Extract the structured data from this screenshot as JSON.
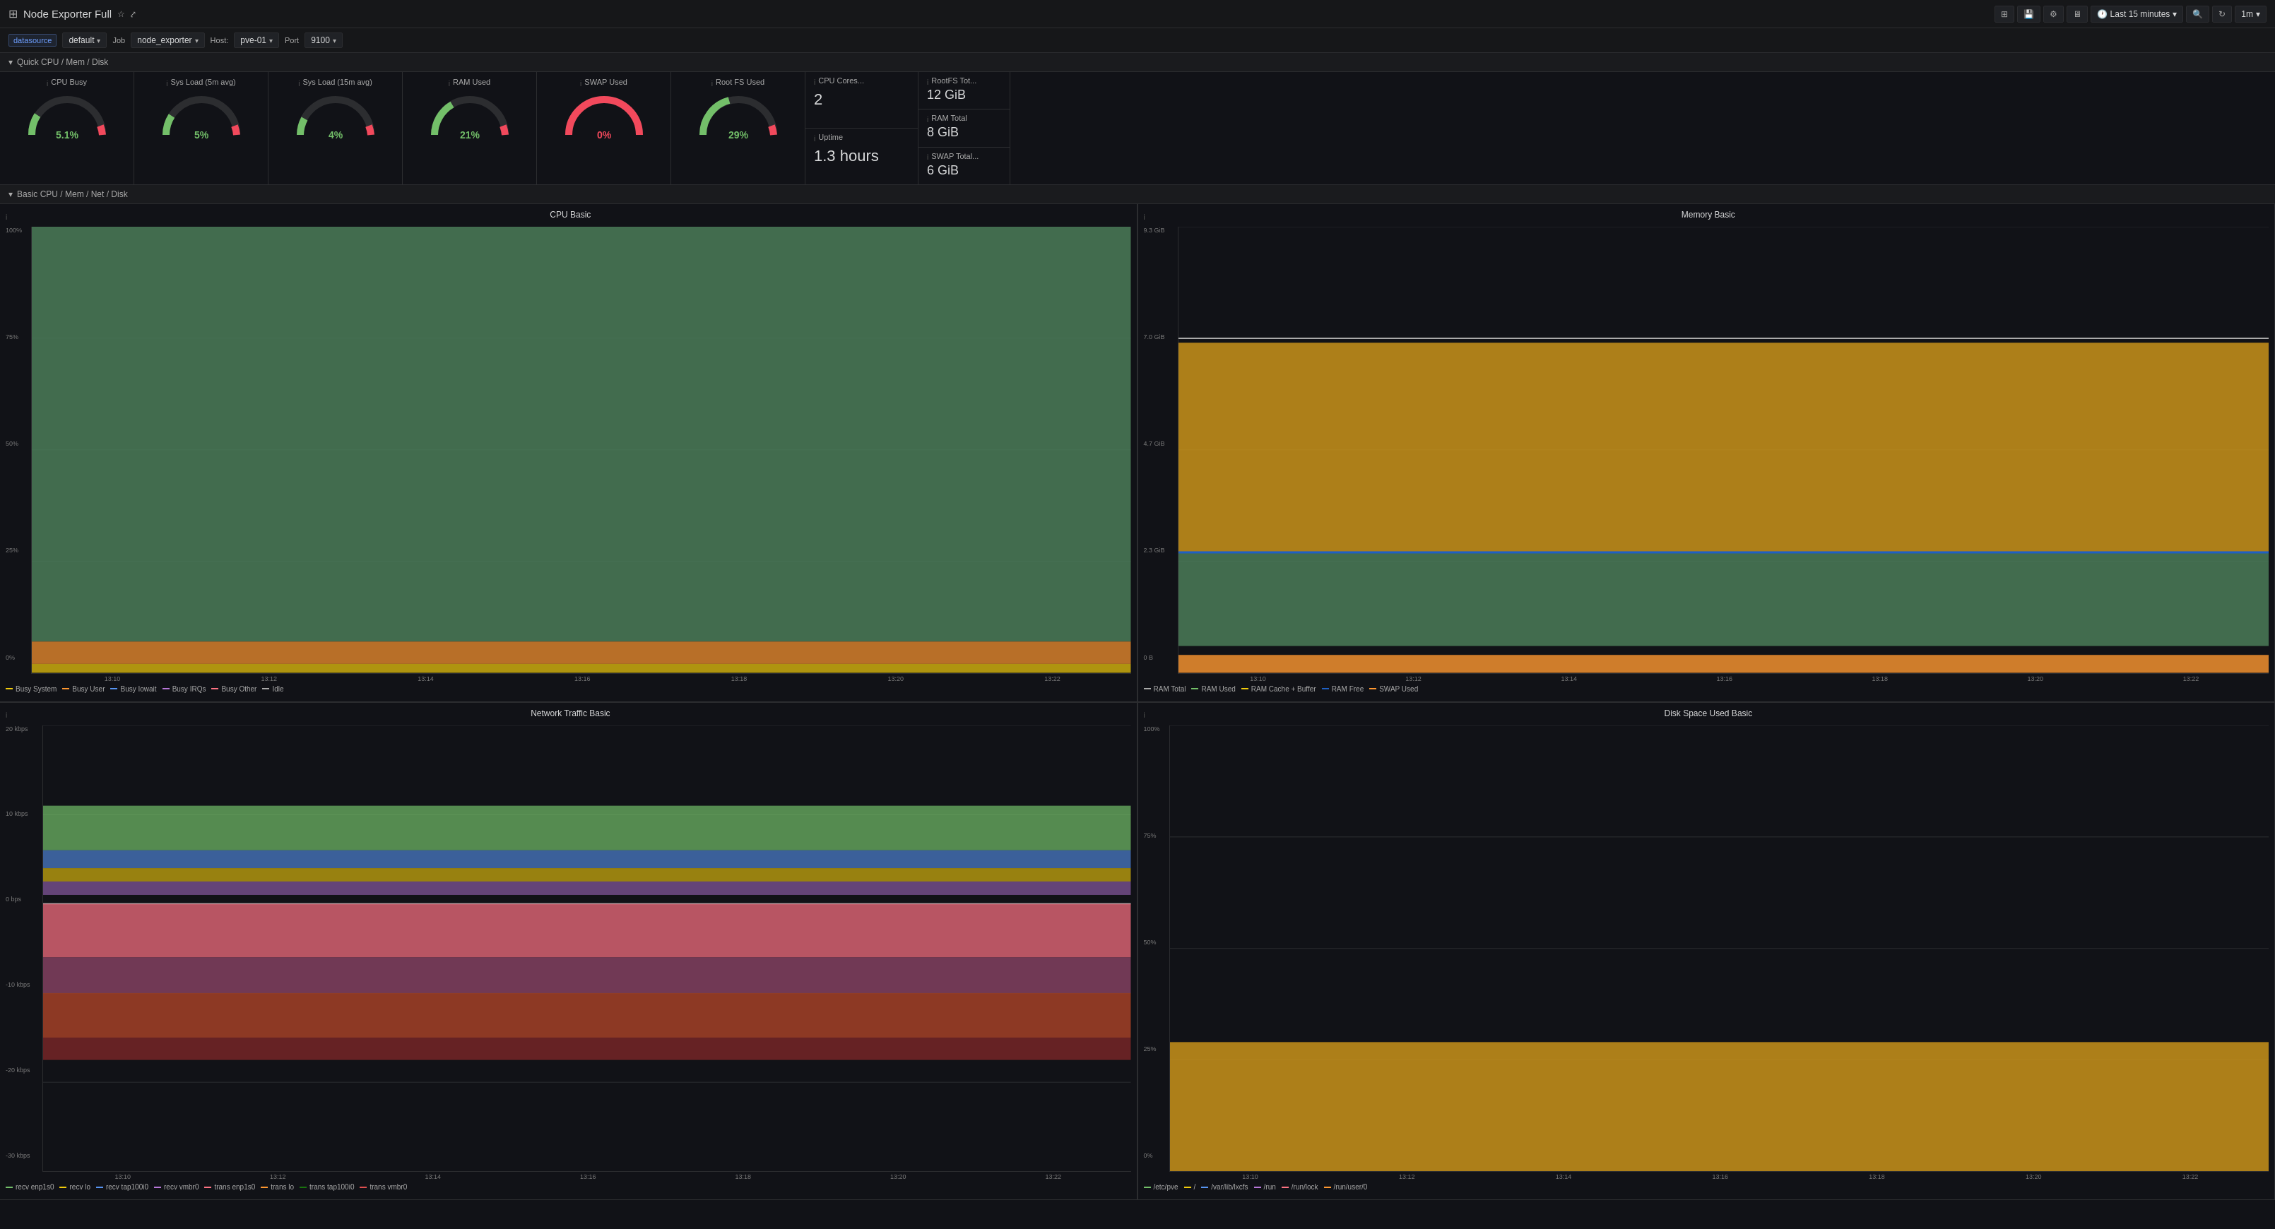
{
  "header": {
    "title": "Node Exporter Full",
    "time_range": "Last 15 minutes",
    "refresh": "1m"
  },
  "toolbar": {
    "datasource_label": "datasource",
    "datasource_value": "default",
    "job_label": "Job",
    "job_value": "node_exporter",
    "host_label": "Host:",
    "host_value": "pve-01",
    "port_label": "Port",
    "port_value": "9100"
  },
  "section_quick": "Quick CPU / Mem / Disk",
  "section_basic": "Basic CPU / Mem / Net / Disk",
  "gauges": [
    {
      "id": "cpu-busy",
      "title": "CPU Busy",
      "value": "5.1%",
      "pct": 5.1,
      "color": "#73bf69"
    },
    {
      "id": "sys-load-5m",
      "title": "Sys Load (5m avg)",
      "value": "5%",
      "pct": 5,
      "color": "#73bf69"
    },
    {
      "id": "sys-load-15m",
      "title": "Sys Load (15m avg)",
      "value": "4%",
      "pct": 4,
      "color": "#73bf69"
    },
    {
      "id": "ram-used",
      "title": "RAM Used",
      "value": "21%",
      "pct": 21,
      "color": "#73bf69"
    },
    {
      "id": "swap-used",
      "title": "SWAP Used",
      "value": "0%",
      "pct": 0,
      "color": "#f2495c"
    },
    {
      "id": "root-fs-used",
      "title": "Root FS Used",
      "value": "29%",
      "pct": 29,
      "color": "#73bf69"
    }
  ],
  "info_panels": [
    {
      "id": "cpu-cores",
      "title": "CPU Cores...",
      "value": "2"
    },
    {
      "id": "uptime",
      "title": "Uptime",
      "value": "1.3 hours"
    }
  ],
  "stat_panels": [
    {
      "id": "rootfs-total",
      "title": "RootFS Tot...",
      "value": "12 GiB"
    },
    {
      "id": "ram-total",
      "title": "RAM Total",
      "value": "8 GiB"
    },
    {
      "id": "swap-total",
      "title": "SWAP Total...",
      "value": "6 GiB"
    }
  ],
  "cpu_chart": {
    "title": "CPU Basic",
    "y_labels": [
      "100%",
      "75%",
      "50%",
      "25%",
      "0%"
    ],
    "x_labels": [
      "13:10",
      "13:12",
      "13:14",
      "13:16",
      "13:18",
      "13:20",
      "13:22"
    ],
    "legend": [
      {
        "label": "Busy System",
        "color": "#f2cc0c"
      },
      {
        "label": "Busy User",
        "color": "#ff9830"
      },
      {
        "label": "Busy Iowait",
        "color": "#5794f2"
      },
      {
        "label": "Busy IRQs",
        "color": "#b877d9"
      },
      {
        "label": "Busy Other",
        "color": "#ff7383"
      },
      {
        "label": "Idle",
        "color": "#aaa"
      }
    ]
  },
  "mem_chart": {
    "title": "Memory Basic",
    "y_labels": [
      "9.3 GiB",
      "7.0 GiB",
      "4.7 GiB",
      "2.3 GiB",
      "0 B"
    ],
    "x_labels": [
      "13:10",
      "13:12",
      "13:14",
      "13:16",
      "13:18",
      "13:20",
      "13:22"
    ],
    "legend": [
      {
        "label": "RAM Total",
        "color": "#aaa"
      },
      {
        "label": "RAM Used",
        "color": "#73bf69"
      },
      {
        "label": "RAM Cache + Buffer",
        "color": "#f2cc0c"
      },
      {
        "label": "RAM Free",
        "color": "#1f60c4"
      },
      {
        "label": "SWAP Used",
        "color": "#ff9830"
      }
    ]
  },
  "net_chart": {
    "title": "Network Traffic Basic",
    "y_labels": [
      "20 kbps",
      "10 kbps",
      "0 bps",
      "-10 kbps",
      "-20 kbps",
      "-30 kbps"
    ],
    "x_labels": [
      "13:10",
      "13:12",
      "13:14",
      "13:16",
      "13:18",
      "13:20",
      "13:22"
    ],
    "legend": [
      {
        "label": "recv enp1s0",
        "color": "#73bf69"
      },
      {
        "label": "recv lo",
        "color": "#f2cc0c"
      },
      {
        "label": "recv tap100i0",
        "color": "#5794f2"
      },
      {
        "label": "recv vmbr0",
        "color": "#b877d9"
      },
      {
        "label": "trans enp1s0",
        "color": "#ff7383"
      },
      {
        "label": "trans lo",
        "color": "#ff9830"
      },
      {
        "label": "trans tap100i0",
        "color": "#19730e"
      },
      {
        "label": "trans vmbr0",
        "color": "#e05050"
      }
    ]
  },
  "disk_chart": {
    "title": "Disk Space Used Basic",
    "y_labels": [
      "100%",
      "75%",
      "50%",
      "25%",
      "0%"
    ],
    "x_labels": [
      "13:10",
      "13:12",
      "13:14",
      "13:16",
      "13:18",
      "13:20",
      "13:22"
    ],
    "legend": [
      {
        "label": "/etc/pve",
        "color": "#73bf69"
      },
      {
        "label": "/",
        "color": "#f2cc0c"
      },
      {
        "label": "/var/lib/lxcfs",
        "color": "#5794f2"
      },
      {
        "label": "/run",
        "color": "#b877d9"
      },
      {
        "label": "/run/lock",
        "color": "#ff7383"
      },
      {
        "label": "/run/user/0",
        "color": "#ff9830"
      }
    ]
  }
}
